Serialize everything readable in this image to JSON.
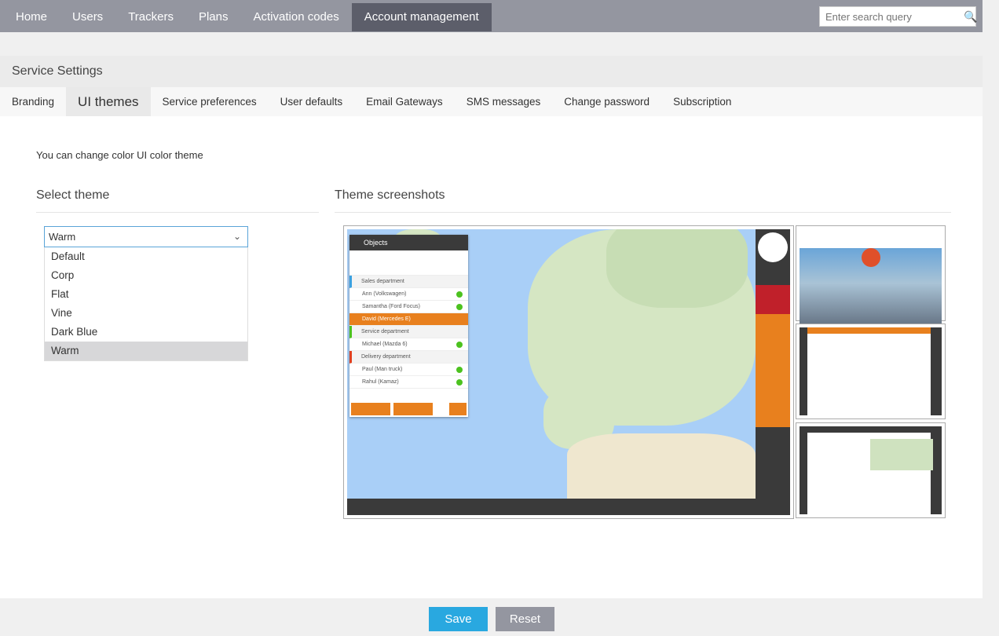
{
  "nav": {
    "items": [
      "Home",
      "Users",
      "Trackers",
      "Plans",
      "Activation codes",
      "Account management"
    ],
    "active": "Account management",
    "search_placeholder": "Enter search query"
  },
  "panel": {
    "title": "Service Settings",
    "tabs": [
      "Branding",
      "UI themes",
      "Service preferences",
      "User defaults",
      "Email Gateways",
      "SMS messages",
      "Change password",
      "Subscription"
    ],
    "active_tab": "UI themes"
  },
  "content": {
    "description": "You can change color UI color theme",
    "select_heading": "Select theme",
    "screens_heading": "Theme screenshots",
    "theme_select": {
      "value": "Warm",
      "options": [
        "Default",
        "Corp",
        "Flat",
        "Vine",
        "Dark Blue",
        "Warm"
      ]
    }
  },
  "preview": {
    "panel_title": "Objects",
    "rows": [
      "Sales department",
      "Ann (Volkswagen)",
      "Samantha (Ford Focus)",
      "David (Mercedes E)",
      "Service department",
      "Michael (Mazda 6)",
      "Delivery department",
      "Paul (Man truck)",
      "Rahul (Kamaz)"
    ],
    "accent": "#e8801e"
  },
  "actions": {
    "save": "Save",
    "reset": "Reset"
  },
  "colors": {
    "nav": "#9496a0",
    "nav_active": "#5c5e6a",
    "save": "#29a8e0",
    "reset": "#9496a0"
  }
}
